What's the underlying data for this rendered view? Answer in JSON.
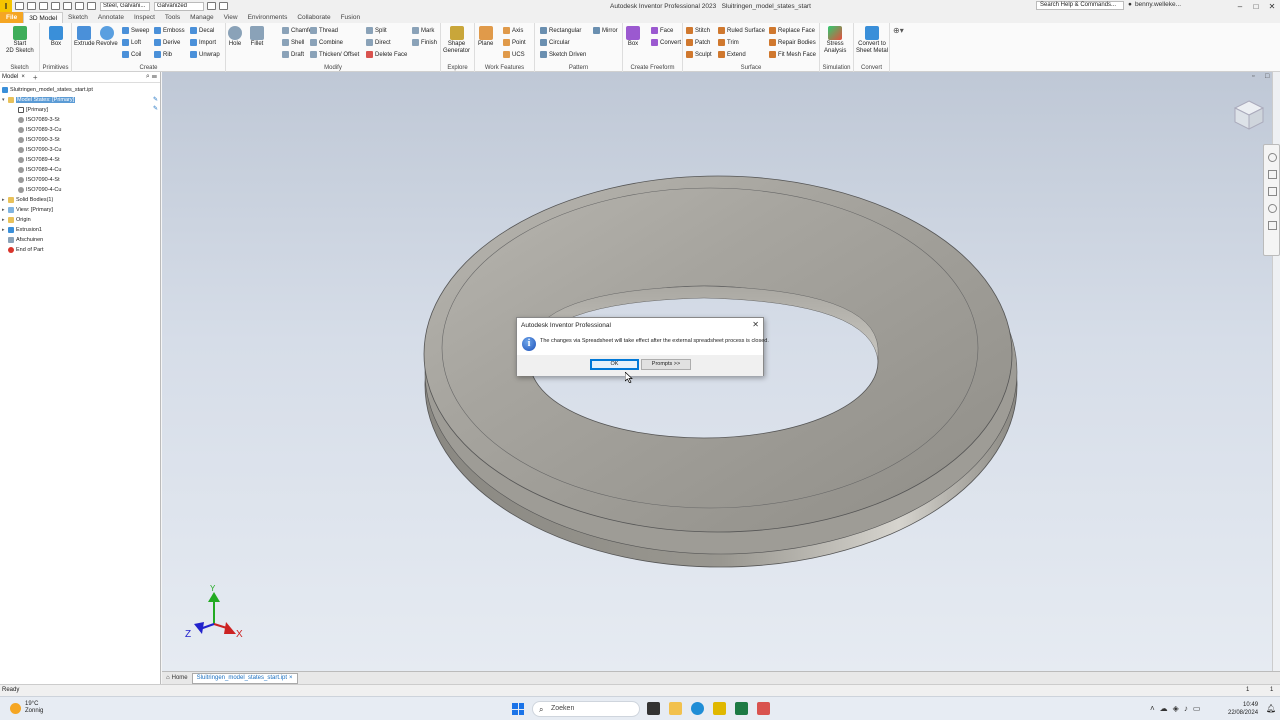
{
  "app": {
    "title": "Autodesk Inventor Professional 2023",
    "document": "Sluitringen_model_states_start",
    "material": "Steel, Galvani...",
    "appearance": "Galvanized",
    "search_placeholder": "Search Help & Commands...",
    "user": "benny.welleke..."
  },
  "tabs": [
    "3D Model",
    "Sketch",
    "Annotate",
    "Inspect",
    "Tools",
    "Manage",
    "View",
    "Environments",
    "Collaborate",
    "Fusion"
  ],
  "file_tab": "File",
  "ribbon": {
    "sketch": {
      "label": "Sketch",
      "start": "Start",
      "start2": "2D Sketch"
    },
    "primitives": {
      "label": "Primitives",
      "box": "Box"
    },
    "create": {
      "label": "Create",
      "extrude": "Extrude",
      "revolve": "Revolve",
      "sweep": "Sweep",
      "loft": "Loft",
      "coil": "Coil",
      "emboss": "Emboss",
      "derive": "Derive",
      "rib": "Rib",
      "decal": "Decal",
      "import": "Import",
      "unwrap": "Unwrap"
    },
    "modify": {
      "label": "Modify",
      "hole": "Hole",
      "fillet": "Fillet",
      "chamfer": "Chamfer",
      "shell": "Shell",
      "draft": "Draft",
      "thread": "Thread",
      "combine": "Combine",
      "thicken": "Thicken/ Offset",
      "split": "Split",
      "direct": "Direct",
      "delete_face": "Delete Face",
      "mark": "Mark",
      "finish": "Finish"
    },
    "explore": {
      "label": "Explore",
      "shape1": "Shape",
      "shape2": "Generator"
    },
    "work": {
      "label": "Work Features",
      "plane": "Plane",
      "axis": "Axis",
      "point": "Point",
      "ucs": "UCS"
    },
    "pattern": {
      "label": "Pattern",
      "rect": "Rectangular",
      "circ": "Circular",
      "sketch_driven": "Sketch Driven",
      "mirror": "Mirror"
    },
    "freeform": {
      "label": "Create Freeform",
      "box": "Box",
      "face": "Face",
      "convert": "Convert"
    },
    "surface": {
      "label": "Surface",
      "stitch": "Stitch",
      "patch": "Patch",
      "sculpt": "Sculpt",
      "ruled": "Ruled Surface",
      "trim": "Trim",
      "extend": "Extend",
      "replace": "Replace Face",
      "repair": "Repair Bodies",
      "fitmesh": "Fit Mesh Face"
    },
    "simulation": {
      "label": "Simulation",
      "stress1": "Stress",
      "stress2": "Analysis"
    },
    "convert": {
      "label": "Convert",
      "c1": "Convert to",
      "c2": "Sheet Metal"
    }
  },
  "browser": {
    "tab": "Model",
    "root": "Sluitringen_model_states_start.ipt",
    "model_states": "Model States: [Primary]",
    "items": [
      "[Primary]",
      "ISO7089-3-St",
      "ISO7089-3-Cu",
      "ISO7090-3-St",
      "ISO7090-3-Cu",
      "ISO7089-4-St",
      "ISO7089-4-Cu",
      "ISO7090-4-St",
      "ISO7090-4-Cu"
    ],
    "solid_bodies": "Solid Bodies(1)",
    "view": "View: [Primary]",
    "origin": "Origin",
    "extrusion": "Extrusion1",
    "afschuinen": "Afschuinen",
    "end": "End of Part"
  },
  "dialog": {
    "title": "Autodesk Inventor Professional",
    "message": "The changes via Spreadsheet will take effect after the external spreadsheet process is closed.",
    "ok": "OK",
    "prompts": "Prompts >>"
  },
  "axes": {
    "x": "X",
    "y": "Y",
    "z": "Z"
  },
  "bottom_tabs": {
    "home": "Home",
    "file": "Sluitringen_model_states_start.ipt"
  },
  "status": {
    "text": "Ready",
    "n1": "1",
    "n2": "1"
  },
  "taskbar": {
    "temp": "19°C",
    "weather": "Zonnig",
    "search": "Zoeken",
    "time": "10:49",
    "date": "22/08/2024"
  }
}
